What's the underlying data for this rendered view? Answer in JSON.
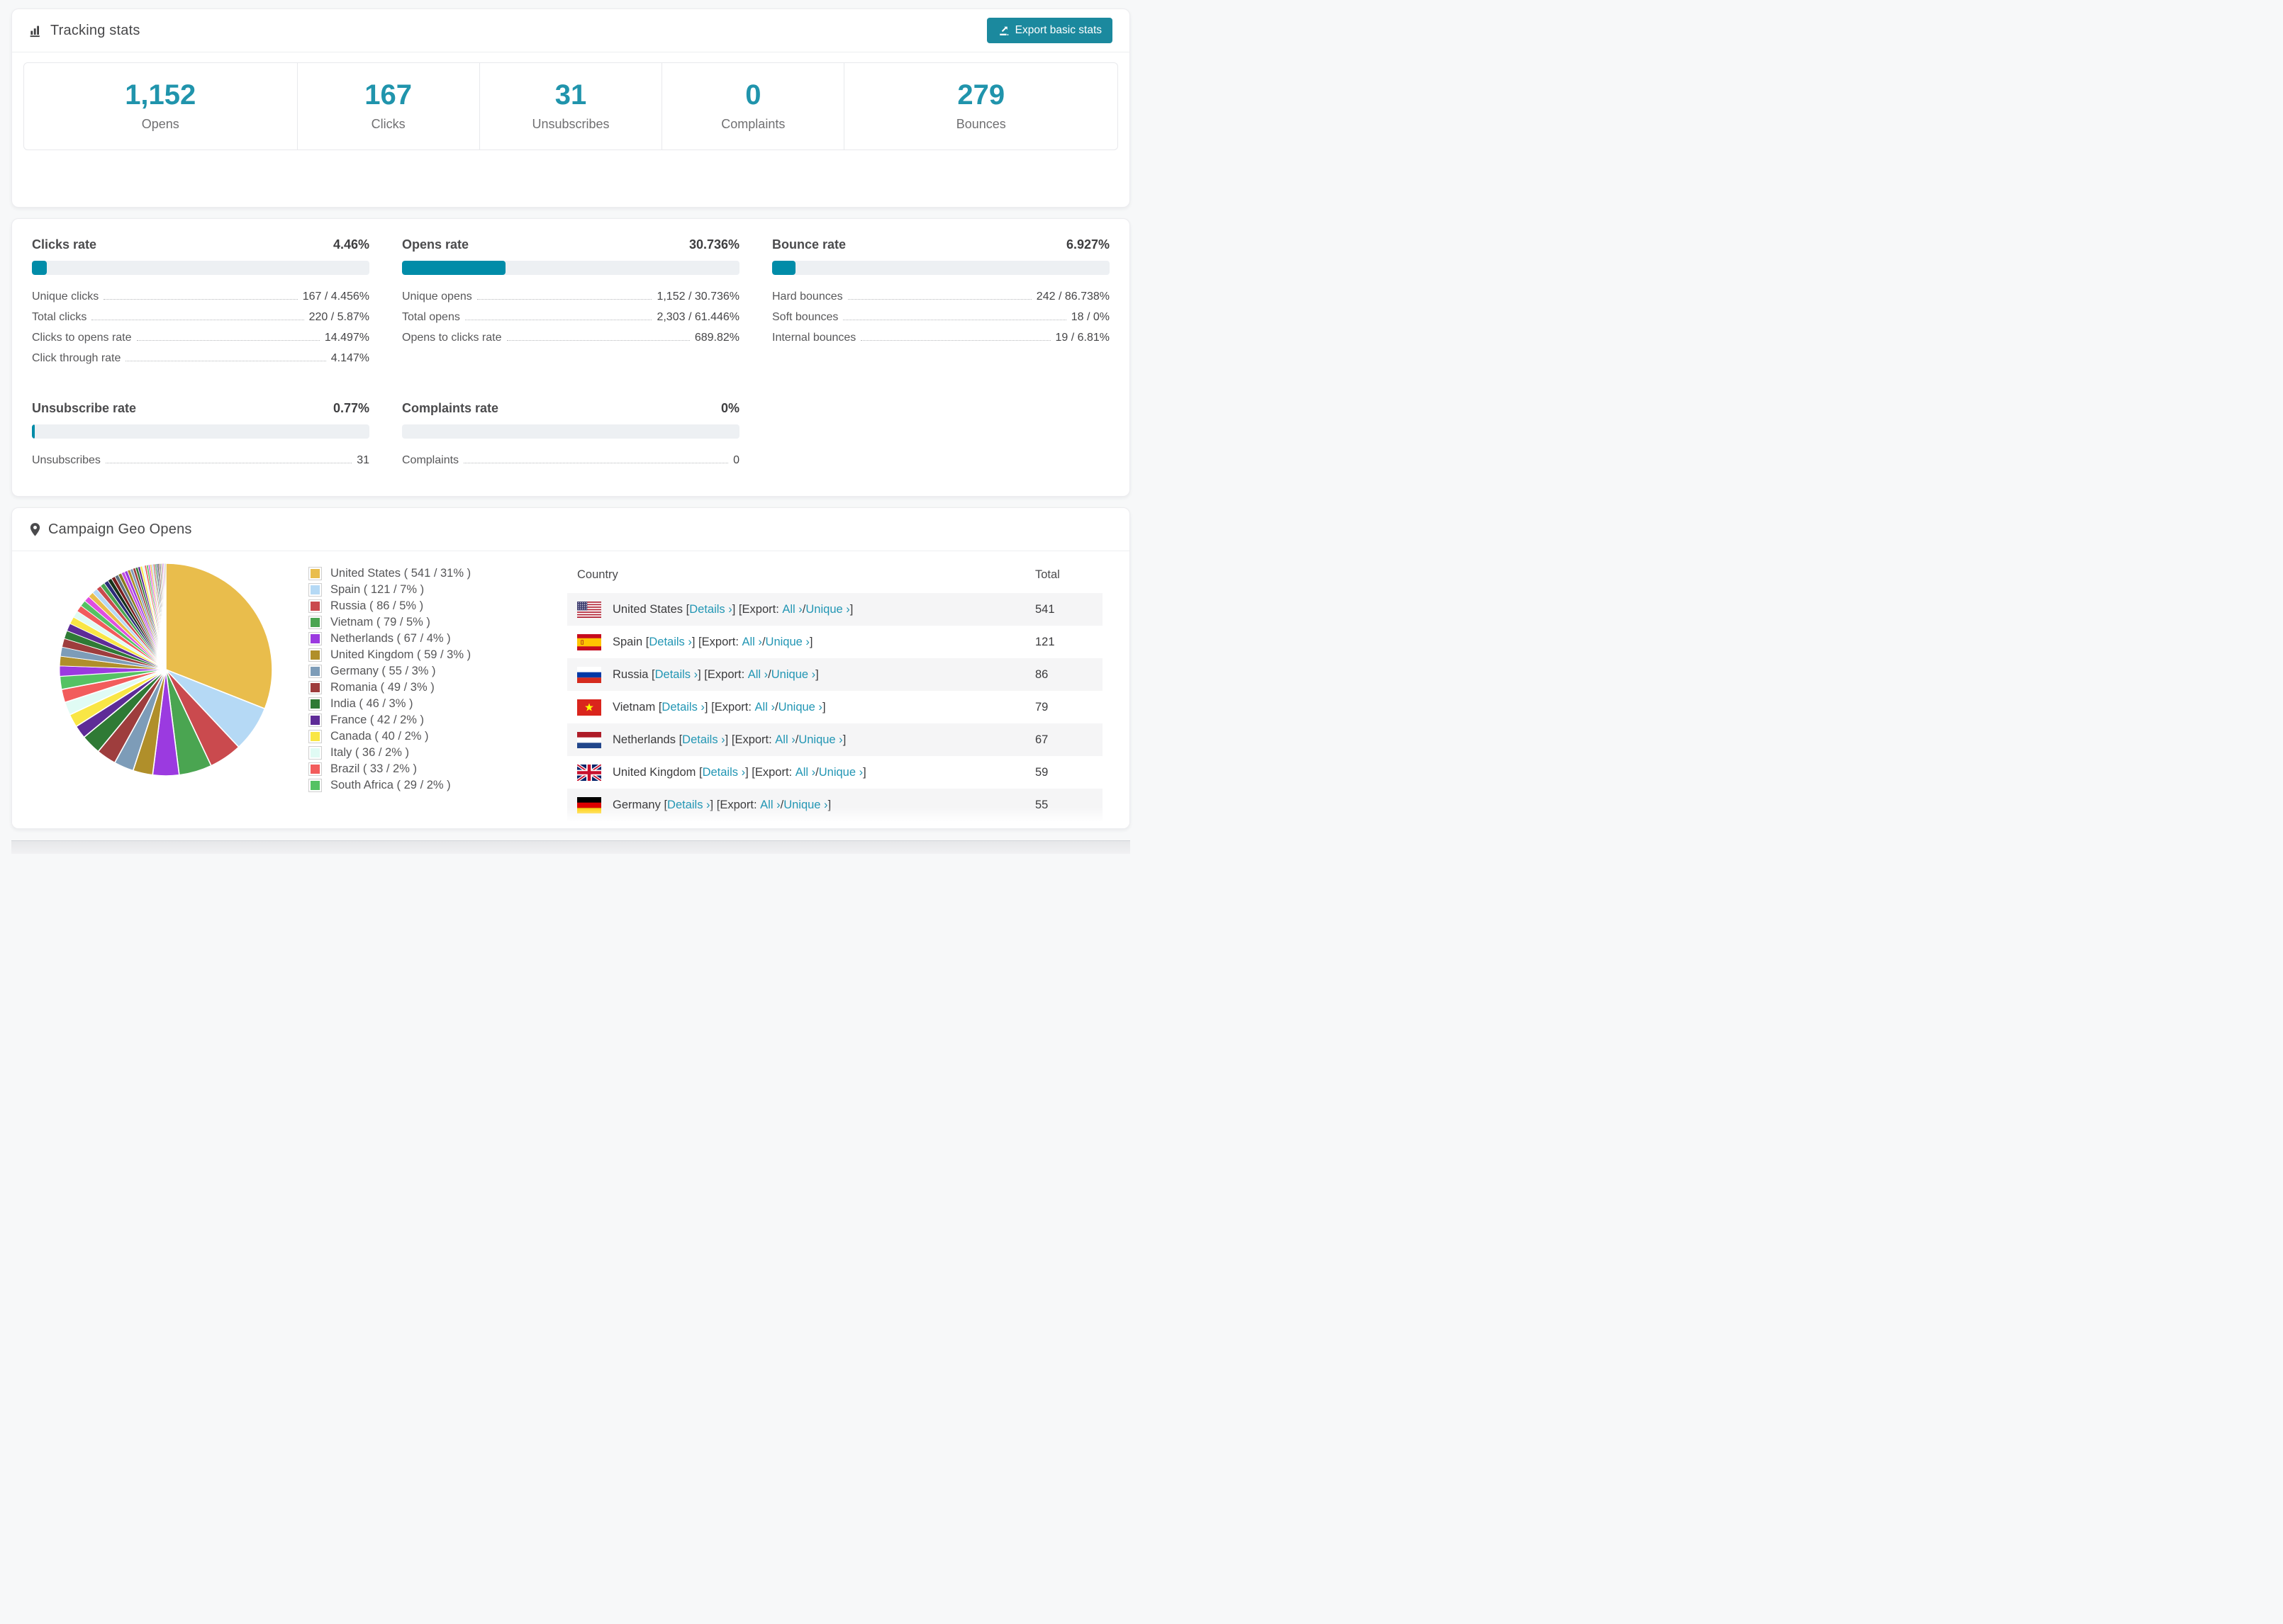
{
  "colors": {
    "accent_teal": "#2094ac",
    "button_bg": "#1b899e",
    "bar_fill": "#008ca8",
    "bar_track": "#edf0f3",
    "link": "#2296b4"
  },
  "tracking": {
    "title": "Tracking stats",
    "export_button": "Export basic stats",
    "stats": [
      {
        "label": "Opens",
        "value": "1,152"
      },
      {
        "label": "Clicks",
        "value": "167"
      },
      {
        "label": "Unsubscribes",
        "value": "31"
      },
      {
        "label": "Complaints",
        "value": "0"
      },
      {
        "label": "Bounces",
        "value": "279"
      }
    ]
  },
  "rates": {
    "sections": [
      {
        "id": "clicks-rate",
        "title": "Clicks rate",
        "value": "4.46%",
        "bar_pct": 4.46,
        "rows": [
          {
            "label": "Unique clicks",
            "value": "167 / 4.456%"
          },
          {
            "label": "Total clicks",
            "value": "220 / 5.87%"
          },
          {
            "label": "Clicks to opens rate",
            "value": "14.497%"
          },
          {
            "label": "Click through rate",
            "value": "4.147%"
          }
        ]
      },
      {
        "id": "opens-rate",
        "title": "Opens rate",
        "value": "30.736%",
        "bar_pct": 30.736,
        "rows": [
          {
            "label": "Unique opens",
            "value": "1,152 / 30.736%"
          },
          {
            "label": "Total opens",
            "value": "2,303 / 61.446%"
          },
          {
            "label": "Opens to clicks rate",
            "value": "689.82%"
          }
        ]
      },
      {
        "id": "bounce-rate",
        "title": "Bounce rate",
        "value": "6.927%",
        "bar_pct": 6.927,
        "rows": [
          {
            "label": "Hard bounces",
            "value": "242 / 86.738%"
          },
          {
            "label": "Soft bounces",
            "value": "18 / 0%"
          },
          {
            "label": "Internal bounces",
            "value": "19 / 6.81%"
          }
        ]
      },
      {
        "id": "unsubscribe-rate",
        "title": "Unsubscribe rate",
        "value": "0.77%",
        "bar_pct": 0.77,
        "rows": [
          {
            "label": "Unsubscribes",
            "value": "31"
          }
        ]
      },
      {
        "id": "complaints-rate",
        "title": "Complaints rate",
        "value": "0%",
        "bar_pct": 0,
        "rows": [
          {
            "label": "Complaints",
            "value": "0"
          }
        ]
      }
    ]
  },
  "geo": {
    "title": "Campaign Geo Opens",
    "table": {
      "headers": [
        "Country",
        "Total"
      ],
      "details_label": "Details ›",
      "export_label": "Export:",
      "all_label": "All ›",
      "unique_label": "Unique ›",
      "rows": [
        {
          "country": "United States",
          "flag": "us",
          "total": "541"
        },
        {
          "country": "Spain",
          "flag": "es",
          "total": "121"
        },
        {
          "country": "Russia",
          "flag": "ru",
          "total": "86"
        },
        {
          "country": "Vietnam",
          "flag": "vn",
          "total": "79"
        },
        {
          "country": "Netherlands",
          "flag": "nl",
          "total": "67"
        },
        {
          "country": "United Kingdom",
          "flag": "gb",
          "total": "59"
        },
        {
          "country": "Germany",
          "flag": "de",
          "total": "55",
          "partial": true
        }
      ]
    }
  },
  "chart_data": {
    "type": "pie",
    "title": "Campaign Geo Opens",
    "legend_position": "right",
    "legend_format": "{label} ( {count} / {pct}% )",
    "slices": [
      {
        "label": "United States",
        "count": 541,
        "pct": 31,
        "color": "#e9bd4c"
      },
      {
        "label": "Spain",
        "count": 121,
        "pct": 7,
        "color": "#b5d9f5"
      },
      {
        "label": "Russia",
        "count": 86,
        "pct": 5,
        "color": "#ca4a4e"
      },
      {
        "label": "Vietnam",
        "count": 79,
        "pct": 5,
        "color": "#4aa551"
      },
      {
        "label": "Netherlands",
        "count": 67,
        "pct": 4,
        "color": "#9b3ae0"
      },
      {
        "label": "United Kingdom",
        "count": 59,
        "pct": 3,
        "color": "#b08f2a"
      },
      {
        "label": "Germany",
        "count": 55,
        "pct": 3,
        "color": "#7d9cb8"
      },
      {
        "label": "Romania",
        "count": 49,
        "pct": 3,
        "color": "#9e3d3d"
      },
      {
        "label": "India",
        "count": 46,
        "pct": 3,
        "color": "#2f7a35"
      },
      {
        "label": "France",
        "count": 42,
        "pct": 2,
        "color": "#5e2b97"
      },
      {
        "label": "Canada",
        "count": 40,
        "pct": 2,
        "color": "#f9e645"
      },
      {
        "label": "Italy",
        "count": 36,
        "pct": 2,
        "color": "#e0fbf4"
      },
      {
        "label": "Brazil",
        "count": 33,
        "pct": 2,
        "color": "#f25c5c"
      },
      {
        "label": "South Africa",
        "count": 29,
        "pct": 2,
        "color": "#55c263"
      }
    ],
    "others": {
      "total_pct": 26,
      "slice_count": 45,
      "decay": 0.945,
      "colors": [
        "#9b3ae0",
        "#b08f2a",
        "#7d9cb8",
        "#9e3d3d",
        "#2f7a35",
        "#5e2b97",
        "#f9e645",
        "#e0fbf4",
        "#f25c5c",
        "#55c263",
        "#e04fe0",
        "#e9bd4c",
        "#b5d9f5",
        "#ca4a4e",
        "#4aa551",
        "#2c2c78",
        "#16321a",
        "#7a2020",
        "#5a6f7e",
        "#8a7a1c",
        "#c44fe0"
      ]
    }
  }
}
